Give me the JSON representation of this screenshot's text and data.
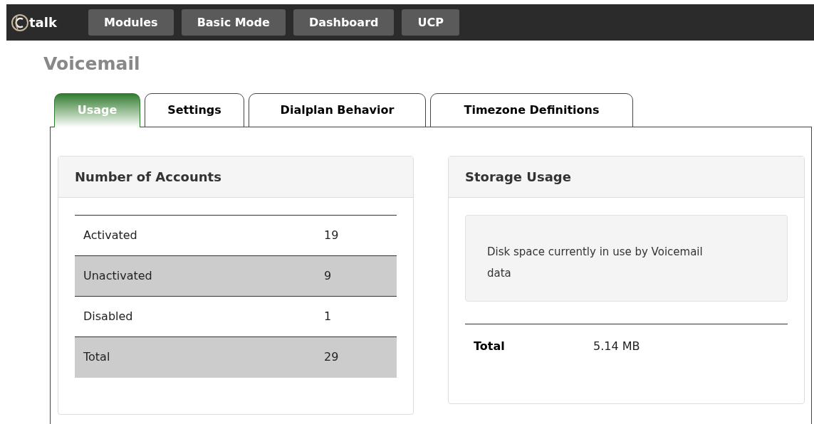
{
  "top_bar": {
    "logo_text": "talk",
    "buttons": [
      "Modules",
      "Basic Mode",
      "Dashboard",
      "UCP"
    ]
  },
  "page_title": "Voicemail",
  "tabs": [
    {
      "label": "Usage",
      "selected": true
    },
    {
      "label": "Settings",
      "selected": false
    },
    {
      "label": "Dialplan Behavior",
      "selected": false
    },
    {
      "label": "Timezone Definitions",
      "selected": false
    }
  ],
  "accounts_panel": {
    "title": "Number of Accounts",
    "rows": [
      {
        "label": "Activated",
        "value": "19"
      },
      {
        "label": "Unactivated",
        "value": "9"
      },
      {
        "label": "Disabled",
        "value": "1"
      },
      {
        "label": "Total",
        "value": "29"
      }
    ]
  },
  "storage_panel": {
    "title": "Storage Usage",
    "description": "Disk space currently in use by Voicemail data",
    "total_label": "Total",
    "total_value": "5.14 MB"
  }
}
